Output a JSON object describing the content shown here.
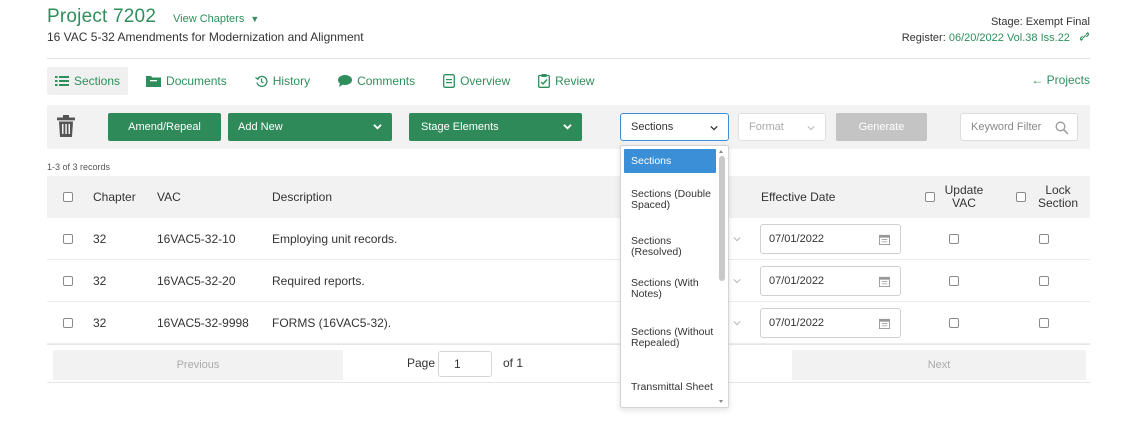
{
  "header": {
    "project_title": "Project 7202",
    "view_chapters": "View Chapters",
    "subtitle": "16 VAC 5-32 Amendments for Modernization and Alignment",
    "stage": "Stage: Exempt Final",
    "register_label": "Register:",
    "register_value": "06/20/2022 Vol.38 Iss.22"
  },
  "tabs": [
    {
      "label": "Sections",
      "icon": "list-icon"
    },
    {
      "label": "Documents",
      "icon": "folder-icon"
    },
    {
      "label": "History",
      "icon": "history-icon"
    },
    {
      "label": "Comments",
      "icon": "comment-icon"
    },
    {
      "label": "Overview",
      "icon": "document-icon"
    },
    {
      "label": "Review",
      "icon": "checklist-icon"
    }
  ],
  "projects_link": "← Projects",
  "toolbar": {
    "amend_repeal": "Amend/Repeal",
    "add_new": "Add New",
    "stage_elements": "Stage Elements",
    "sections_select": "Sections",
    "format_select": "Format",
    "generate": "Generate",
    "keyword_placeholder": "Keyword Filter"
  },
  "records_count": "1-3 of 3 records",
  "table": {
    "headers": {
      "chapter": "Chapter",
      "vac": "VAC",
      "description": "Description",
      "effective_date": "Effective Date",
      "update_vac": "Update VAC",
      "lock_section": "Lock Section"
    },
    "rows": [
      {
        "chapter": "32",
        "vac": "16VAC5-32-10",
        "description": "Employing unit records.",
        "effective_date": "07/01/2022"
      },
      {
        "chapter": "32",
        "vac": "16VAC5-32-20",
        "description": "Required reports.",
        "effective_date": "07/01/2022"
      },
      {
        "chapter": "32",
        "vac": "16VAC5-32-9998",
        "description": "FORMS (16VAC5-32).",
        "effective_date": "07/01/2022"
      }
    ]
  },
  "pagination": {
    "previous": "Previous",
    "page_label": "Page",
    "page_value": "1",
    "of_label": "of 1",
    "next": "Next"
  },
  "dropdown": {
    "options": [
      "Sections",
      "Sections (Double Spaced)",
      "Sections (Resolved)",
      "Sections (With Notes)",
      "Sections (Without Repealed)",
      "Transmittal Sheet"
    ],
    "selected": "Sections"
  },
  "colors": {
    "brand_green": "#2e8f5c",
    "link_blue": "#3a8ed0",
    "selected_blue": "#3b8fd6"
  }
}
